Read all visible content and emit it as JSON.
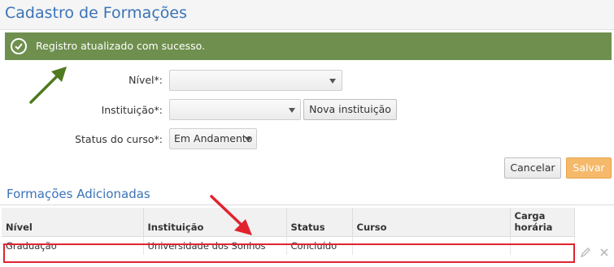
{
  "header": {
    "title": "Cadastro de Formações"
  },
  "alert": {
    "message": "Registro atualizado com sucesso."
  },
  "form": {
    "nivel": {
      "label": "Nível*:",
      "value": ""
    },
    "instituicao": {
      "label": "Instituição*:",
      "value": "",
      "new_button": "Nova instituição"
    },
    "status": {
      "label": "Status do curso*:",
      "value": "Em Andamento"
    }
  },
  "actions": {
    "cancel": "Cancelar",
    "save": "Salvar"
  },
  "section": {
    "title": "Formações Adicionadas"
  },
  "table": {
    "headers": {
      "nivel": "Nível",
      "instituicao": "Instituição",
      "status": "Status",
      "curso": "Curso",
      "carga1": "Carga",
      "carga2": "horária"
    },
    "rows": [
      {
        "nivel": "Graduação",
        "instituicao": "Universidade dos Sonhos",
        "status": "Concluído",
        "curso": "",
        "carga": ""
      }
    ]
  },
  "colors": {
    "accent": "#3a73b8",
    "success": "#6f8f4e",
    "annotation_green": "#4f7a1f",
    "annotation_red": "#e0232f",
    "save": "#f5b969"
  },
  "icons": {
    "alert": "check-circle-icon",
    "edit": "pencil-icon",
    "delete": "close-icon"
  }
}
